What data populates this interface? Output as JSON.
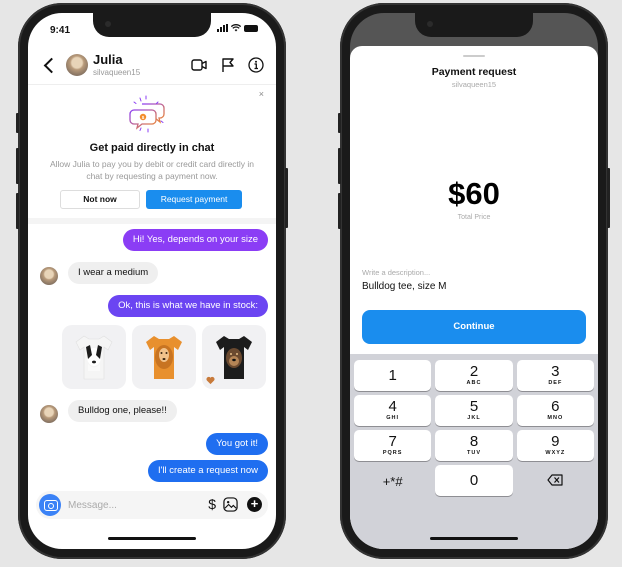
{
  "left_phone": {
    "status_bar": {
      "time": "9:41"
    },
    "header": {
      "name": "Julia",
      "username": "silvaqueen15",
      "icons": [
        "back-icon",
        "video-call-icon",
        "flag-icon",
        "info-icon"
      ]
    },
    "promo": {
      "close_label": "×",
      "title": "Get paid directly in chat",
      "description": "Allow Julia to pay you by debit or credit card directly in chat by requesting a payment now.",
      "not_now_label": "Not now",
      "request_label": "Request payment"
    },
    "messages": [
      {
        "direction": "outgoing",
        "text": "Hi! Yes, depends on your size",
        "color": "#8b3df5"
      },
      {
        "direction": "incoming",
        "text": "I wear a medium"
      },
      {
        "direction": "outgoing",
        "text": "Ok, this is what we have in stock:",
        "color": "#6b45f2"
      },
      {
        "direction": "incoming",
        "text": "Bulldog one, please!!"
      },
      {
        "direction": "outgoing",
        "text": "You got it!",
        "color": "#1f6ef0"
      },
      {
        "direction": "outgoing",
        "text": "I'll create a request now",
        "color": "#1f6ef0"
      }
    ],
    "products": [
      {
        "name": "White border collie tee",
        "color": "#f5f5f5"
      },
      {
        "name": "Orange golden retriever tee",
        "color": "#e8902e"
      },
      {
        "name": "Black rottweiler tee",
        "color": "#1c1c1c",
        "reaction": "heart"
      }
    ],
    "composer": {
      "placeholder": "Message...",
      "dollar_label": "$",
      "plus_label": "+"
    }
  },
  "right_phone": {
    "sheet": {
      "title": "Payment request",
      "username": "silvaqueen15",
      "amount": "$60",
      "amount_label": "Total Price",
      "description_placeholder": "Write a description...",
      "description_value": "Bulldog tee, size M",
      "continue_label": "Continue"
    },
    "keypad": [
      [
        {
          "num": "1",
          "letters": ""
        },
        {
          "num": "2",
          "letters": "ABC"
        },
        {
          "num": "3",
          "letters": "DEF"
        }
      ],
      [
        {
          "num": "4",
          "letters": "GHI"
        },
        {
          "num": "5",
          "letters": "JKL"
        },
        {
          "num": "6",
          "letters": "MNO"
        }
      ],
      [
        {
          "num": "7",
          "letters": "PQRS"
        },
        {
          "num": "8",
          "letters": "TUV"
        },
        {
          "num": "9",
          "letters": "WXYZ"
        }
      ],
      [
        {
          "num": "+*#",
          "letters": ""
        },
        {
          "num": "0",
          "letters": ""
        },
        {
          "num": "backspace",
          "letters": ""
        }
      ]
    ]
  },
  "colors": {
    "accent_blue": "#1a8dee",
    "background": "#e6e6e6"
  }
}
